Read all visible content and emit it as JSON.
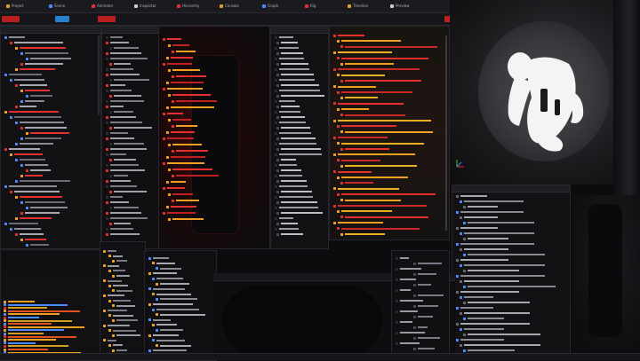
{
  "tabs": [
    {
      "label": "Project",
      "color": "#e0a020"
    },
    {
      "label": "Scene",
      "color": "#4a8cff"
    },
    {
      "label": "Animator",
      "color": "#e03030"
    },
    {
      "label": "Inspector",
      "color": "#d0d0d0"
    },
    {
      "label": "Hierarchy",
      "color": "#e03030"
    },
    {
      "label": "Console",
      "color": "#e0a020"
    },
    {
      "label": "Graph",
      "color": "#4a8cff"
    },
    {
      "label": "Rig",
      "color": "#e03030"
    },
    {
      "label": "Timeline",
      "color": "#e0a020"
    },
    {
      "label": "Preview",
      "color": "#d0d0d0"
    }
  ],
  "toolbar": {
    "play_label": "",
    "record_label": ""
  },
  "panels": {
    "hierarchy_title": "",
    "inspector_title": "",
    "graph_title": "",
    "properties_title": "",
    "assets_title": "",
    "timeline_title": ""
  },
  "colors": {
    "accent_red": "#e53030",
    "accent_orange": "#f0a020",
    "accent_blue": "#4a8cff",
    "background": "#0c0c0e"
  },
  "icons": [
    "folder-icon",
    "bone-icon",
    "mesh-icon",
    "curve-icon",
    "play-icon",
    "record-icon"
  ]
}
